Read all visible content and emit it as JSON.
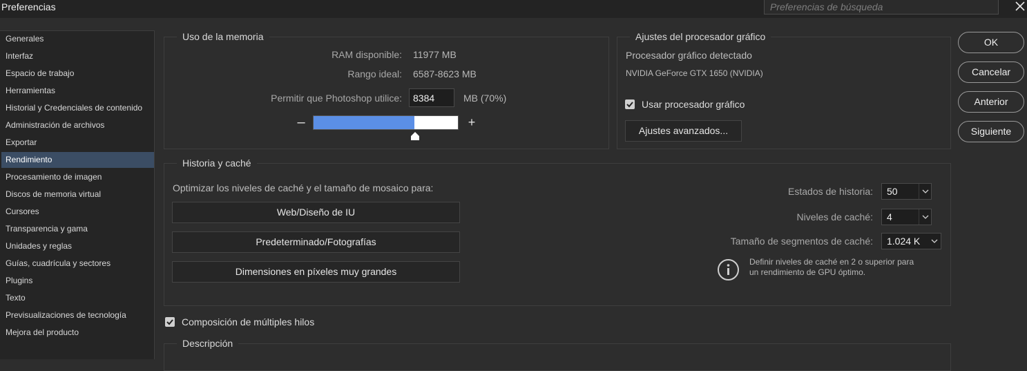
{
  "window": {
    "title": "Preferencias",
    "search_placeholder": "Preferencias de búsqueda"
  },
  "sidebar": {
    "items": [
      "Generales",
      "Interfaz",
      "Espacio de trabajo",
      "Herramientas",
      "Historial y Credenciales de contenido",
      "Administración de archivos",
      "Exportar",
      "Rendimiento",
      "Procesamiento de imagen",
      "Discos de memoria virtual",
      "Cursores",
      "Transparencia y gama",
      "Unidades y reglas",
      "Guías, cuadrícula y sectores",
      "Plugins",
      "Texto",
      "Previsualizaciones de tecnología",
      "Mejora del producto"
    ],
    "active": "Rendimiento"
  },
  "memory": {
    "title": "Uso de la memoria",
    "ram_label": "RAM disponible:",
    "ram_value": "11977 MB",
    "ideal_label": "Rango ideal:",
    "ideal_value": "6587-8623 MB",
    "allow_label": "Permitir que Photoshop utilice:",
    "allow_value": "8384",
    "allow_unit": "MB (70%)",
    "usage_fraction": 0.7,
    "minus": "–",
    "plus": "+"
  },
  "gpu": {
    "title": "Ajustes del procesador gráfico",
    "detected_label": "Procesador gráfico detectado",
    "gpu_name": "NVIDIA GeForce GTX 1650 (NVIDIA)",
    "use_gpu_label": "Usar procesador gráfico",
    "use_gpu_checked": true,
    "advanced_button": "Ajustes avanzados..."
  },
  "history": {
    "title": "Historia y caché",
    "optimize_label": "Optimizar los niveles de caché y el tamaño de mosaico para:",
    "buttons": [
      "Web/Diseño de IU",
      "Predeterminado/Fotografías",
      "Dimensiones en píxeles muy grandes"
    ],
    "states_label": "Estados de historia:",
    "states_value": "50",
    "cache_levels_label": "Niveles de caché:",
    "cache_levels_value": "4",
    "tile_size_label": "Tamaño de segmentos de caché:",
    "tile_size_value": "1.024 K",
    "info_text": "Definir niveles de caché en 2 o superior para un rendimiento de GPU óptimo."
  },
  "multithread": {
    "label": "Composición de múltiples hilos",
    "checked": true
  },
  "description": {
    "title": "Descripción"
  },
  "actions": {
    "ok": "OK",
    "cancel": "Cancelar",
    "previous": "Anterior",
    "next": "Siguiente"
  },
  "icons": {
    "close": "close-icon",
    "info": "info-icon",
    "check": "checkmark-icon",
    "chevron": "chevron-down-icon"
  },
  "colors": {
    "background": "#2d2d2d",
    "sidebar": "#252525",
    "active_item": "#3b4d64",
    "slider_fill": "#5b8fe6"
  }
}
